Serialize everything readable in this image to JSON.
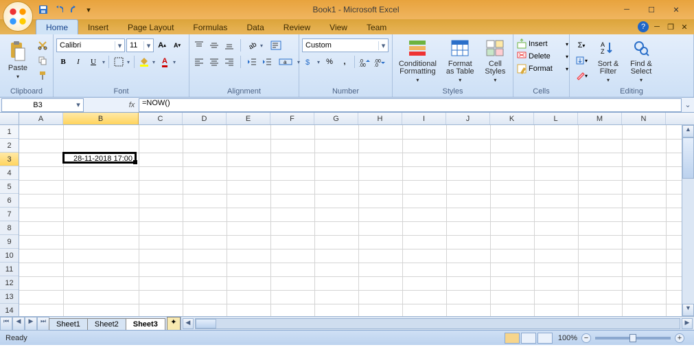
{
  "title": "Book1 - Microsoft Excel",
  "tabs": [
    "Home",
    "Insert",
    "Page Layout",
    "Formulas",
    "Data",
    "Review",
    "View",
    "Team"
  ],
  "active_tab": "Home",
  "ribbon": {
    "clipboard": {
      "label": "Clipboard",
      "paste": "Paste"
    },
    "font": {
      "label": "Font",
      "name": "Calibri",
      "size": "11"
    },
    "alignment": {
      "label": "Alignment"
    },
    "number": {
      "label": "Number",
      "format": "Custom"
    },
    "styles": {
      "label": "Styles",
      "cond": "Conditional\nFormatting",
      "table": "Format\nas Table",
      "cell": "Cell\nStyles"
    },
    "cells": {
      "label": "Cells",
      "insert": "Insert",
      "delete": "Delete",
      "format": "Format"
    },
    "editing": {
      "label": "Editing",
      "sort": "Sort &\nFilter",
      "find": "Find &\nSelect"
    }
  },
  "namebox": "B3",
  "formula": "=NOW()",
  "columns": [
    "A",
    "B",
    "C",
    "D",
    "E",
    "F",
    "G",
    "H",
    "I",
    "J",
    "K",
    "L",
    "M",
    "N"
  ],
  "wide_col": "B",
  "sel_col": "B",
  "rows": [
    1,
    2,
    3,
    4,
    5,
    6,
    7,
    8,
    9,
    10,
    11,
    12,
    13,
    14
  ],
  "sel_row": 3,
  "cell_value": "28-11-2018 17:00",
  "sheets": [
    "Sheet1",
    "Sheet2",
    "Sheet3"
  ],
  "active_sheet": "Sheet3",
  "status": "Ready",
  "zoom": "100%"
}
